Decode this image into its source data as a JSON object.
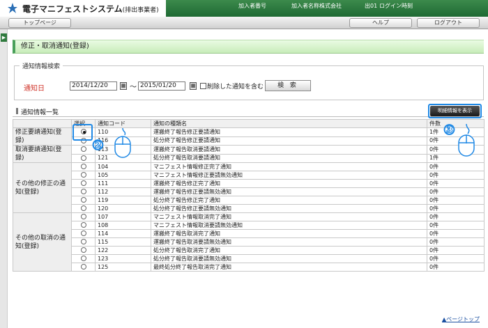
{
  "header": {
    "title": "電子マニフェストシステム",
    "subtitle": "(排出事業者)",
    "fields": [
      "加入者番号",
      "加入者名称",
      "株式会社",
      "出01",
      "ログイン時刻"
    ]
  },
  "nav": {
    "top": "トップページ",
    "help": "ヘルプ",
    "logout": "ログアウト"
  },
  "page_title": "修正・取消通知(登録)",
  "search": {
    "legend": "通知情報検索",
    "label": "通知日",
    "date_from": "2014/12/20",
    "date_to": "2015/01/20",
    "tilde": "〜",
    "checkbox_label": "削除した通知を含む",
    "button": "検 索"
  },
  "list": {
    "title": "通知情報一覧",
    "detail_button": "明細情報を表示",
    "columns": [
      "選択",
      "通知コード",
      "通知の種類名",
      "件数"
    ],
    "groups": [
      {
        "name": "修正要請通知(登録)",
        "rows": [
          {
            "code": "110",
            "name": "運搬終了報告修正要請通知",
            "count": "1件",
            "selected": true
          },
          {
            "code": "116",
            "name": "処分終了報告修正要請通知",
            "count": "0件"
          }
        ]
      },
      {
        "name": "取消要請通知(登録)",
        "rows": [
          {
            "code": "113",
            "name": "運搬終了報告取消要請通知",
            "count": "0件"
          },
          {
            "code": "121",
            "name": "処分終了報告取消要請通知",
            "count": "1件"
          }
        ]
      },
      {
        "name": "その他の修正の通知(登録)",
        "rows": [
          {
            "code": "104",
            "name": "マニフェスト情報修正完了通知",
            "count": "0件"
          },
          {
            "code": "105",
            "name": "マニフェスト情報修正要請無効通知",
            "count": "0件"
          },
          {
            "code": "111",
            "name": "運搬終了報告修正完了通知",
            "count": "0件"
          },
          {
            "code": "112",
            "name": "運搬終了報告修正要請無効通知",
            "count": "0件"
          },
          {
            "code": "119",
            "name": "処分終了報告修正完了通知",
            "count": "0件"
          },
          {
            "code": "120",
            "name": "処分終了報告修正要請無効通知",
            "count": "0件"
          }
        ]
      },
      {
        "name": "その他の取消の通知(登録)",
        "rows": [
          {
            "code": "107",
            "name": "マニフェスト情報取消完了通知",
            "count": "0件"
          },
          {
            "code": "108",
            "name": "マニフェスト情報取消要請無効通知",
            "count": "0件"
          },
          {
            "code": "114",
            "name": "運搬終了報告取消完了通知",
            "count": "0件"
          },
          {
            "code": "115",
            "name": "運搬終了報告取消要請無効通知",
            "count": "0件"
          },
          {
            "code": "122",
            "name": "処分終了報告取消完了通知",
            "count": "0件"
          },
          {
            "code": "123",
            "name": "処分終了報告取消要請無効通知",
            "count": "0件"
          },
          {
            "code": "125",
            "name": "最終処分終了報告取消完了通知",
            "count": "0件"
          }
        ]
      }
    ]
  },
  "annotations": {
    "step2": "②",
    "step3": "③"
  },
  "page_top": "▲ページトップ",
  "colors": {
    "accent": "#1e88e5",
    "header_green": "#2f7a3e",
    "required": "#d0352b"
  }
}
